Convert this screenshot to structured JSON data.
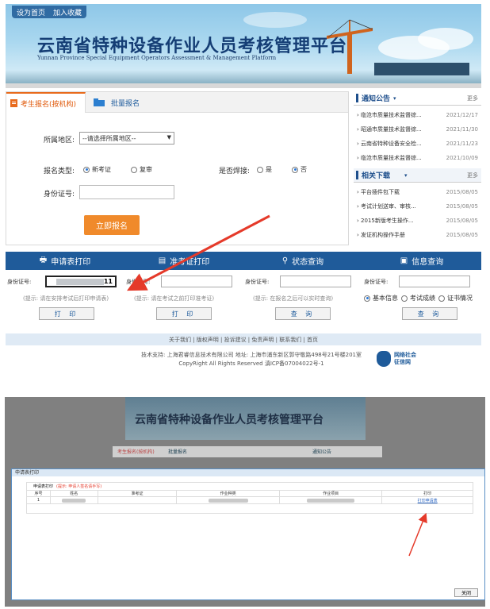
{
  "top_links": {
    "home": "设为首页",
    "fav": "加入收藏"
  },
  "platform": {
    "title": "云南省特种设备作业人员考核管理平台",
    "subtitle": "Yunnan Province Special Equipment Operators Assessment & Management Platform"
  },
  "tabs": {
    "tab1": "考生报名(按机构)",
    "tab2": "批量报名"
  },
  "form": {
    "region_label": "所属地区:",
    "region_value": "--请选择所属地区--",
    "type_label": "报名类型:",
    "type_new": "新考证",
    "type_review": "复审",
    "weld_label": "是否焊接:",
    "weld_yes": "是",
    "weld_no": "否",
    "id_label": "身份证号:",
    "submit": "立即报名"
  },
  "notices": {
    "title": "通知公告",
    "more": "更多",
    "items": [
      {
        "text": "临沧市质量技术监督综...",
        "date": "2021/12/17"
      },
      {
        "text": "昭通市质量技术监督综...",
        "date": "2021/11/30"
      },
      {
        "text": "云南省特种设备安全检...",
        "date": "2021/11/23"
      },
      {
        "text": "临沧市质量技术监督综...",
        "date": "2021/10/09"
      }
    ]
  },
  "downloads": {
    "title": "相关下载",
    "more": "更多",
    "items": [
      {
        "text": "平台插件包下载",
        "date": "2015/08/05"
      },
      {
        "text": "考试计划送审、审核...",
        "date": "2015/08/05"
      },
      {
        "text": "2015新版考生操作...",
        "date": "2015/08/05"
      },
      {
        "text": "发证机构操作手册",
        "date": "2015/08/05"
      }
    ]
  },
  "query_bar": {
    "q1": "申请表打印",
    "q2": "准考证打印",
    "q3": "状态查询",
    "q4": "信息查询"
  },
  "query": {
    "id_label": "身份证号:",
    "id1_value": "11",
    "hint1": "(提示: 请在安排考试后打印申请表)",
    "hint2": "(提示: 请在考试之前打印准考证)",
    "hint3": "(提示: 在报名之后可以实时查询)",
    "print": "打 印",
    "query": "查 询",
    "opt_basic": "基本信息",
    "opt_score": "考试成绩",
    "opt_cert": "证书情况"
  },
  "footer": {
    "links": "关于我们 | 版权声明 | 投诉建议 | 免责声明 | 联系我们 | 首页",
    "support": "技术支持: 上海君睿信息技术有限公司    地址: 上海市浦东新区郭守敬路498号21号楼201室",
    "copyright": "CopyRight All Rights Reserved  滇ICP备07004022号-1",
    "logo1": "网络社会",
    "logo2": "征信网"
  },
  "dialog": {
    "title": "申请表打印",
    "heading": "申请表打印",
    "hint": "(提示: 申请人签名请手写)",
    "cols": [
      "序号",
      "姓名",
      "准考证",
      "作业种类",
      "作业项目",
      "打印"
    ],
    "row": {
      "idx": "1",
      "action": "打印申请表"
    },
    "close": "关闭"
  },
  "colors": {
    "accent": "#1f5b9a",
    "orange": "#f08a2b",
    "red": "#e53a2a"
  }
}
